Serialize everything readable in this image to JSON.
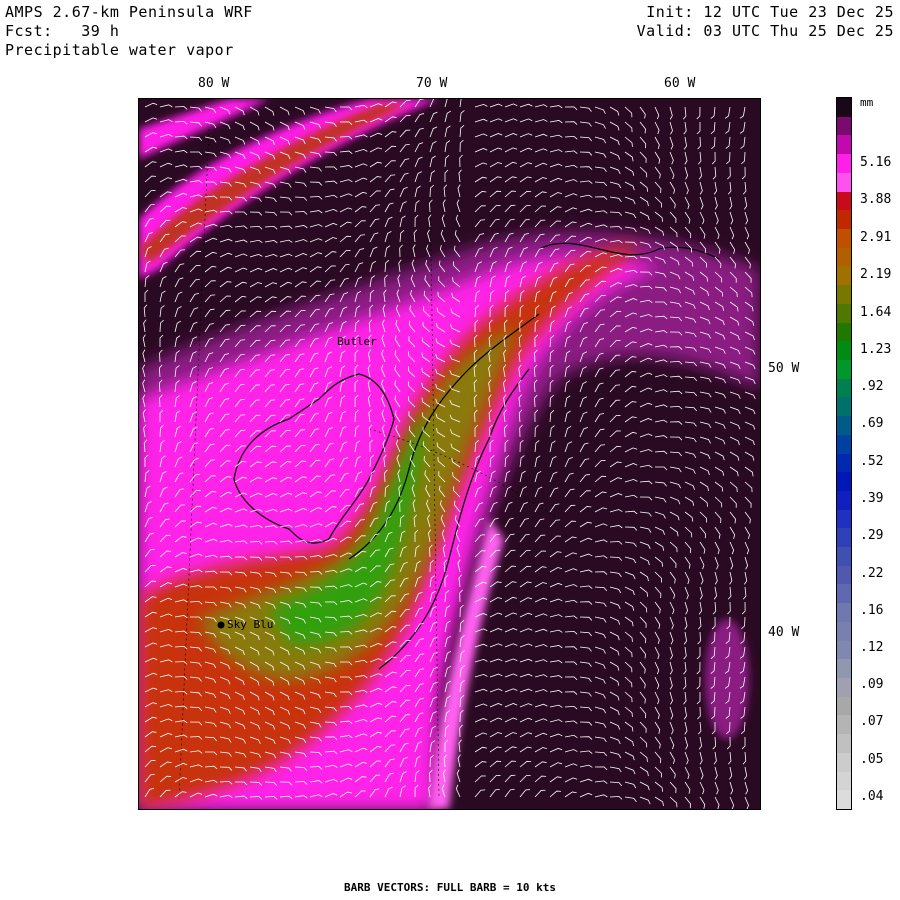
{
  "header": {
    "title": "AMPS 2.67-km Peninsula WRF",
    "forecast": "Fcst:   39 h",
    "field": "Precipitable water vapor",
    "init": "Init: 12 UTC Tue 23 Dec 25",
    "valid": "Valid: 03 UTC Thu 25 Dec 25"
  },
  "map": {
    "lon_labels": [
      "80 W",
      "70 W",
      "60 W"
    ],
    "lat_labels": [
      "50 W",
      "40 W"
    ],
    "stations": [
      {
        "name": "Sky Blu"
      },
      {
        "name": "Butler"
      }
    ]
  },
  "legend": {
    "unit": "mm",
    "labels": [
      "5.16",
      "3.88",
      "2.91",
      "2.19",
      "1.64",
      "1.23",
      ".92",
      ".69",
      ".52",
      ".39",
      ".29",
      ".22",
      ".16",
      ".12",
      ".09",
      ".07",
      ".05",
      ".04"
    ],
    "colors": [
      "#1a0818",
      "#7a0a6e",
      "#c00ab0",
      "#ff20e8",
      "#ff50f0",
      "#c80a1a",
      "#c02800",
      "#c05000",
      "#b06000",
      "#a07000",
      "#787800",
      "#507800",
      "#207800",
      "#008c14",
      "#009828",
      "#008050",
      "#00706c",
      "#005a88",
      "#0040a0",
      "#0028b0",
      "#0018b8",
      "#1020c0",
      "#2030c0",
      "#3040b8",
      "#4050b0",
      "#5058b0",
      "#6068b0",
      "#7078b0",
      "#7880b0",
      "#8088b0",
      "#9098b0",
      "#a0a0b0",
      "#a8a8a8",
      "#b4b4b4",
      "#c0c0c0",
      "#cccccc",
      "#d4d4d4",
      "#dcdcdc"
    ]
  },
  "footer": "BARB VECTORS:  FULL BARB = 10 kts"
}
